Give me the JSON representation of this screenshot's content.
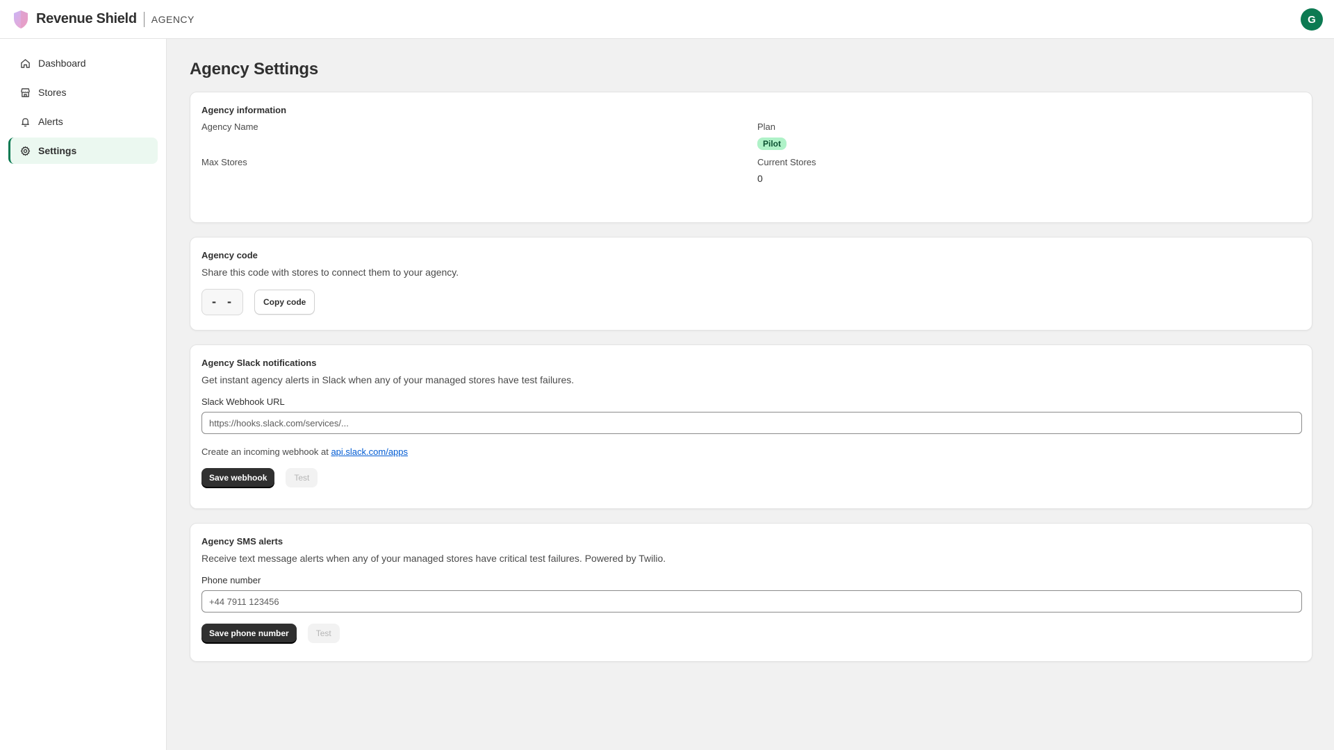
{
  "header": {
    "brand_name": "Revenue Shield",
    "brand_tag": "AGENCY",
    "avatar_initial": "G",
    "logo_icon": "shield-logo-icon"
  },
  "sidebar": {
    "items": [
      {
        "label": "Dashboard",
        "icon": "home-icon",
        "active": false
      },
      {
        "label": "Stores",
        "icon": "store-icon",
        "active": false
      },
      {
        "label": "Alerts",
        "icon": "bell-icon",
        "active": false
      },
      {
        "label": "Settings",
        "icon": "gear-icon",
        "active": true
      }
    ]
  },
  "page": {
    "title": "Agency Settings"
  },
  "agency_info": {
    "title": "Agency information",
    "name_label": "Agency Name",
    "name_value": "",
    "plan_label": "Plan",
    "plan_value": "Pilot",
    "max_stores_label": "Max Stores",
    "max_stores_value": "",
    "current_stores_label": "Current Stores",
    "current_stores_value": "0"
  },
  "agency_code": {
    "title": "Agency code",
    "description": "Share this code with stores to connect them to your agency.",
    "code_value": "- -",
    "copy_label": "Copy code"
  },
  "slack": {
    "title": "Agency Slack notifications",
    "description": "Get instant agency alerts in Slack when any of your managed stores have test failures.",
    "field_label": "Slack Webhook URL",
    "placeholder": "https://hooks.slack.com/services/...",
    "value": "",
    "help_prefix": "Create an incoming webhook at ",
    "help_link": "api.slack.com/apps",
    "save_label": "Save webhook",
    "test_label": "Test"
  },
  "sms": {
    "title": "Agency SMS alerts",
    "description": "Receive text message alerts when any of your managed stores have critical test failures. Powered by Twilio.",
    "field_label": "Phone number",
    "placeholder": "+44 7911 123456",
    "value": "",
    "save_label": "Save phone number",
    "test_label": "Test"
  },
  "colors": {
    "accent": "#0c7a52",
    "active_bg": "#ebf8f0",
    "badge_bg": "#aff2c8",
    "primary_button": "#303030",
    "link": "#005bd3"
  }
}
